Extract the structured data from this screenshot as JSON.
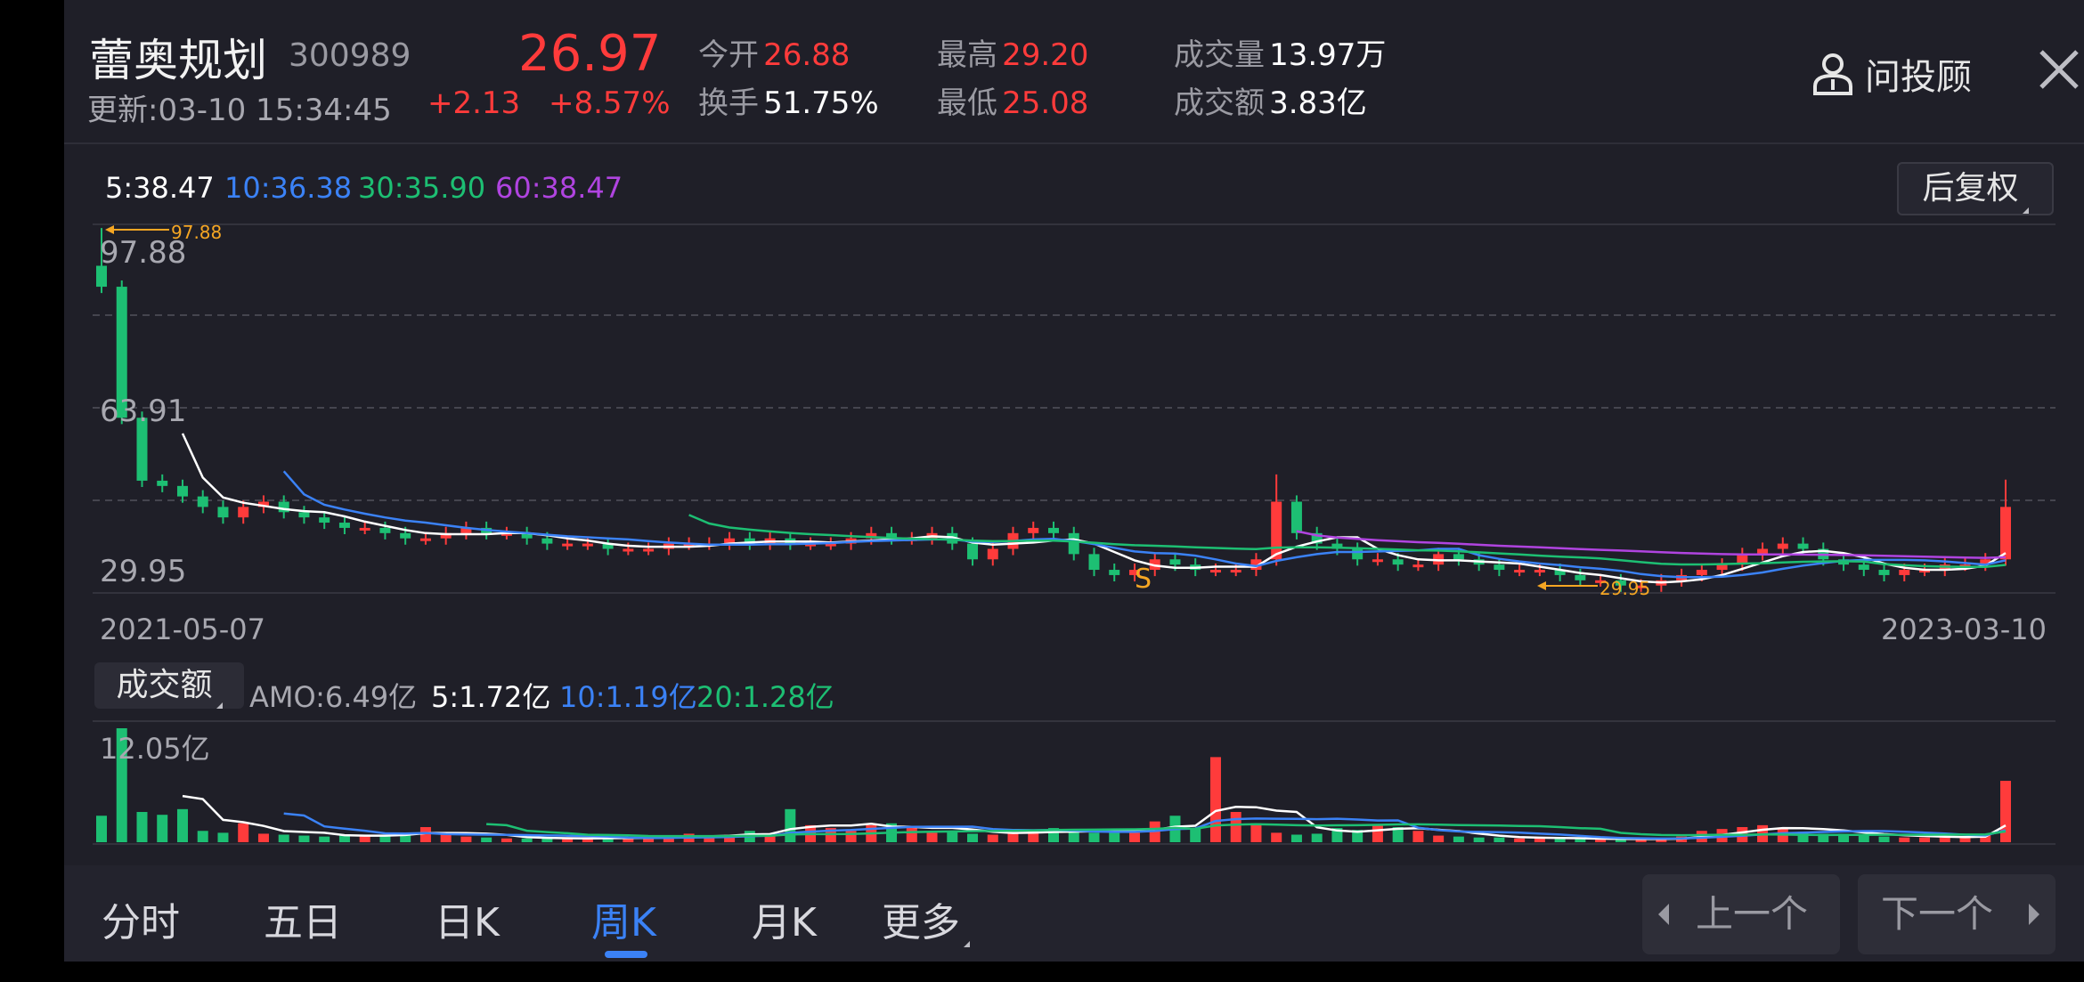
{
  "header": {
    "stock_name": "蕾奥规划",
    "stock_code": "300989",
    "price": "26.97",
    "update_time": "更新:03-10 15:34:45",
    "change": "+2.13",
    "change_pct": "+8.57%",
    "open_label": "今开",
    "open_value": "26.88",
    "turnover_label": "换手",
    "turnover_value": "51.75%",
    "high_label": "最高",
    "high_value": "29.20",
    "low_label": "最低",
    "low_value": "25.08",
    "volume_label": "成交量",
    "volume_value": "13.97万",
    "amount_label": "成交额",
    "amount_value": "3.83亿",
    "advisor_label": "问投顾"
  },
  "ma": {
    "ma5": "5:38.47",
    "ma10": "10:36.38",
    "ma30": "30:35.90",
    "ma60": "60:38.47"
  },
  "adjust_button": "后复权",
  "price_chart": {
    "y_labels": [
      "97.88",
      "63.91",
      "29.95"
    ],
    "max_marker": "97.88",
    "min_marker": "29.95",
    "signal_marker": "S",
    "start_date": "2021-05-07",
    "end_date": "2023-03-10"
  },
  "amount_panel": {
    "button_label": "成交额",
    "amo": "AMO:6.49亿",
    "ma5": "5:1.72亿",
    "ma10": "10:1.19亿",
    "ma20": "20:1.28亿",
    "top_label": "12.05亿"
  },
  "tabs": [
    "分时",
    "五日",
    "日K",
    "周K",
    "月K",
    "更多"
  ],
  "active_tab": "周K",
  "nav": {
    "prev": "上一个",
    "next": "下一个"
  },
  "colors": {
    "up": "#ff3b3b",
    "down": "#1dbf73",
    "ma5": "#ffffff",
    "ma10": "#3b82f6",
    "ma30": "#1dbf73",
    "ma60": "#b044e0",
    "marker": "#f5a623",
    "background": "#1f1f28"
  },
  "chart_data": {
    "type": "candlestick",
    "period": "weekly",
    "x_range": [
      "2021-05-07",
      "2023-03-10"
    ],
    "ylim": [
      29.95,
      97.88
    ],
    "series_ma": [
      {
        "name": "5",
        "last": 38.47
      },
      {
        "name": "10",
        "last": 36.38
      },
      {
        "name": "30",
        "last": 35.9
      },
      {
        "name": "60",
        "last": 38.47
      }
    ],
    "candles_close": [
      87,
      62,
      50,
      49,
      47,
      45,
      43,
      45,
      46,
      44,
      43,
      42,
      41,
      41,
      40,
      39,
      39,
      40,
      41,
      40,
      40,
      39,
      38,
      38,
      38,
      37,
      37,
      37,
      38,
      38,
      38,
      39,
      38,
      39,
      38,
      38,
      38,
      39,
      40,
      39,
      39,
      40,
      38,
      35,
      37,
      40,
      41,
      40,
      36,
      33,
      32,
      33,
      35,
      34,
      33,
      33,
      33,
      35,
      46,
      40,
      38,
      37,
      35,
      35,
      34,
      34,
      36,
      35,
      34,
      33,
      33,
      33,
      32,
      31,
      31,
      30,
      30,
      31,
      32,
      33,
      34,
      36,
      37,
      38,
      37,
      35,
      34,
      33,
      32,
      33,
      33,
      34,
      34,
      35,
      45
    ],
    "amount": [
      2.8,
      12.05,
      3.2,
      2.9,
      3.5,
      1.2,
      1.0,
      2.0,
      0.9,
      0.8,
      0.7,
      0.6,
      0.7,
      0.7,
      0.8,
      1.0,
      1.6,
      0.8,
      0.6,
      0.5,
      0.4,
      0.4,
      0.4,
      0.4,
      0.4,
      0.5,
      0.5,
      0.5,
      0.6,
      0.9,
      0.6,
      0.8,
      1.2,
      0.8,
      3.5,
      1.8,
      1.5,
      1.2,
      1.8,
      2.0,
      1.6,
      1.0,
      1.2,
      0.9,
      0.8,
      1.0,
      1.2,
      1.5,
      1.1,
      1.0,
      1.2,
      1.0,
      2.2,
      2.8,
      1.5,
      9.0,
      3.2,
      2.0,
      1.0,
      0.8,
      0.9,
      1.5,
      1.3,
      1.8,
      1.6,
      1.2,
      0.7,
      0.6,
      0.5,
      0.5,
      0.4,
      0.4,
      0.4,
      0.4,
      0.3,
      0.3,
      0.3,
      0.4,
      0.6,
      1.2,
      1.4,
      1.6,
      1.8,
      1.5,
      1.1,
      0.9,
      0.9,
      0.8,
      0.6,
      0.5,
      0.5,
      0.5,
      0.6,
      0.8,
      6.49
    ]
  }
}
